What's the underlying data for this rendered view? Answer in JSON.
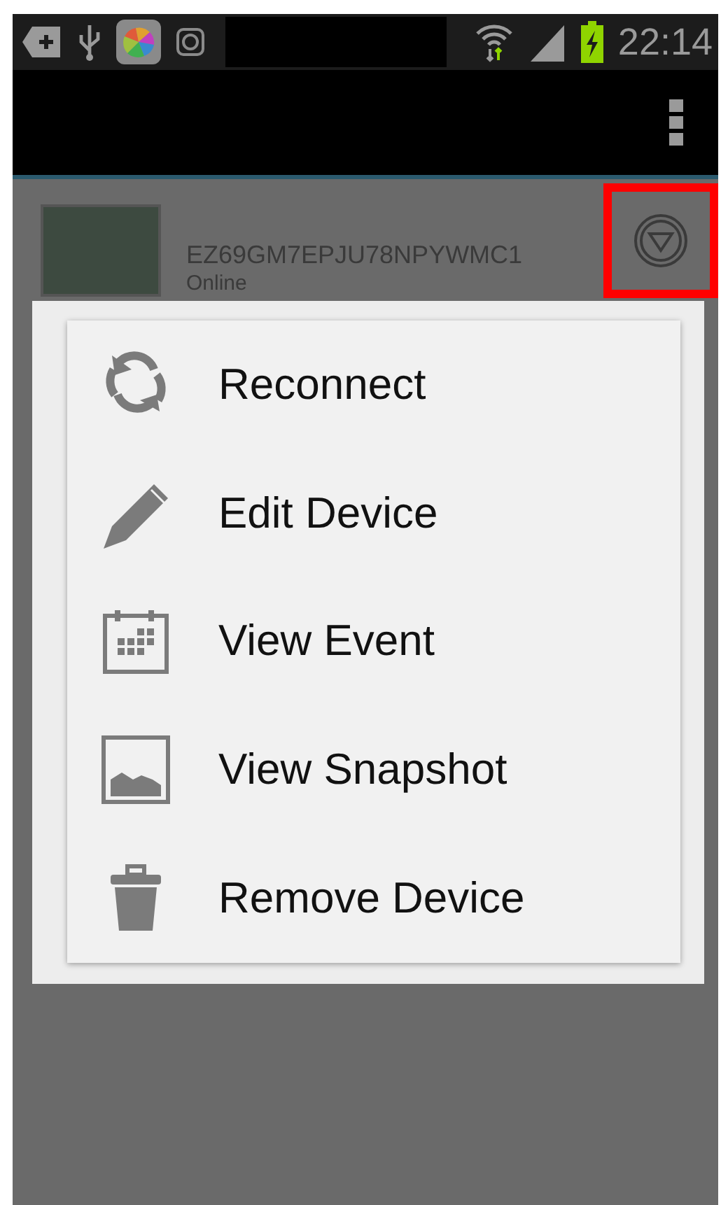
{
  "status_bar": {
    "time": "22:14"
  },
  "device": {
    "id": "EZ69GM7EPJU78NPYWMC1",
    "status": "Online",
    "highlighted": true
  },
  "menu": {
    "items": [
      {
        "label": "Reconnect",
        "kind": "refresh"
      },
      {
        "label": "Edit Device",
        "kind": "edit"
      },
      {
        "label": "View Event",
        "kind": "calendar"
      },
      {
        "label": "View Snapshot",
        "kind": "image"
      },
      {
        "label": "Remove Device",
        "kind": "delete"
      }
    ]
  }
}
